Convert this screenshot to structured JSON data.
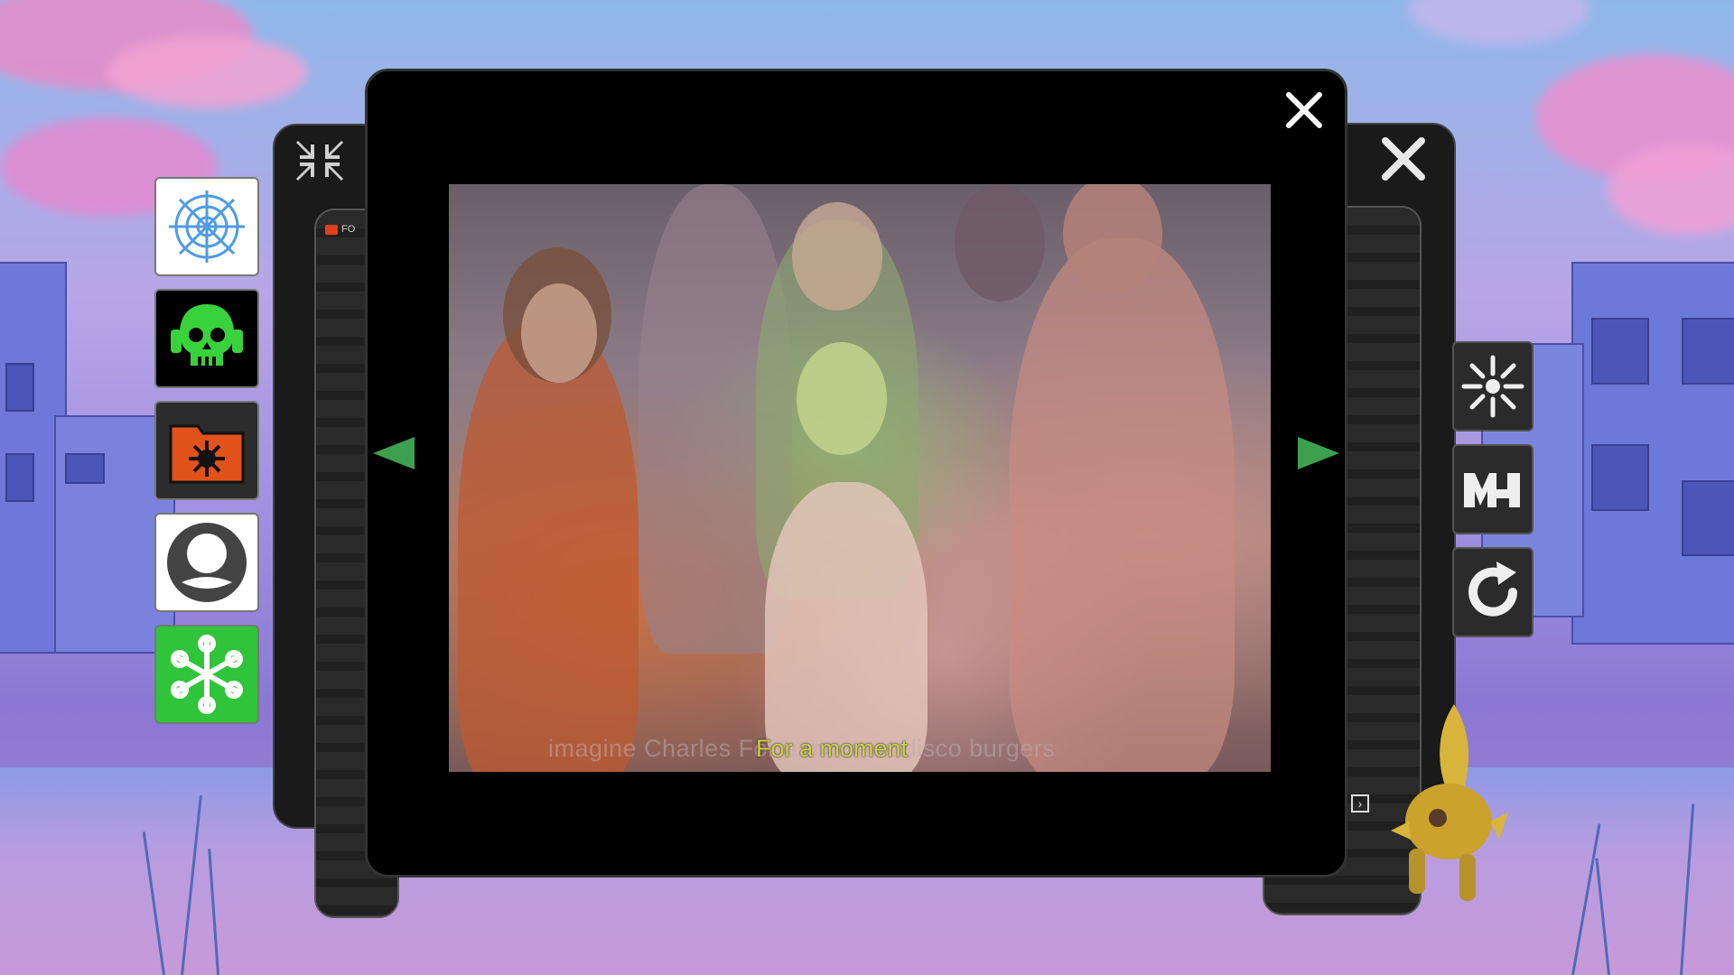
{
  "viewer": {
    "subtitle_primary": "For a moment",
    "subtitle_secondary": "imagine Charles For a moment disco burgers",
    "close_icon": "close-icon",
    "prev_icon": "arrow-left-icon",
    "next_icon": "arrow-right-icon",
    "arrow_color": "#3da04f"
  },
  "back_window_left": {
    "folder_label": "FO",
    "compress_icon": "compress-icon"
  },
  "back_window_right": {
    "close_icon": "close-icon",
    "nav_icon": "chevron-right-icon"
  },
  "left_dock": [
    {
      "name": "spiderweb",
      "icon": "spiderweb-icon",
      "bg": "#ffffff"
    },
    {
      "name": "skull-headphones",
      "icon": "skull-headphones-icon",
      "bg": "#000000"
    },
    {
      "name": "virus-folder",
      "icon": "virus-folder-icon",
      "bg": "#333333"
    },
    {
      "name": "user-circle",
      "icon": "user-circle-icon",
      "bg": "#ffffff"
    },
    {
      "name": "snowflake-green",
      "icon": "snowflake-icon",
      "bg": "#2fc43a"
    }
  ],
  "right_dock": [
    {
      "name": "burst",
      "icon": "burst-icon"
    },
    {
      "name": "logo-mh",
      "icon": "mh-logo-icon"
    },
    {
      "name": "refresh",
      "icon": "refresh-icon"
    }
  ]
}
